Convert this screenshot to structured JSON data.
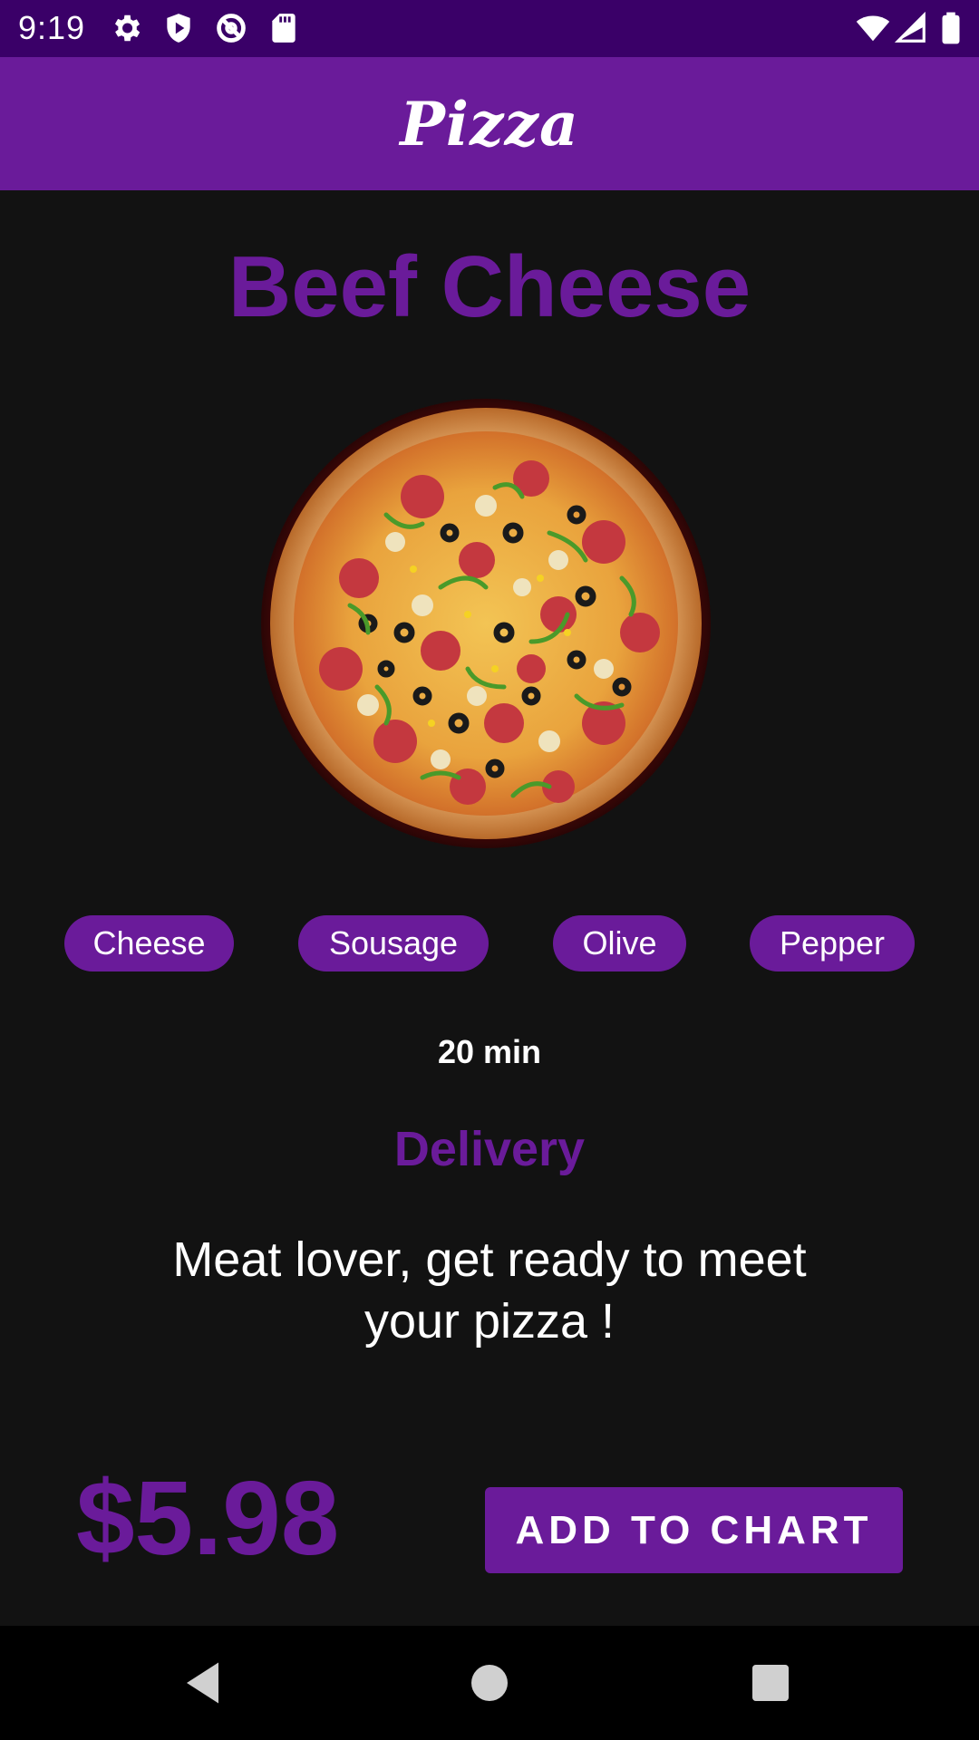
{
  "status_bar": {
    "time": "9:19",
    "icons": [
      "gear-icon",
      "shield-play-icon",
      "circle-slash-icon",
      "sd-card-icon",
      "wifi-icon",
      "signal-icon",
      "battery-icon"
    ]
  },
  "app_bar": {
    "title": "Pizza"
  },
  "pizza": {
    "name": "Beef Cheese",
    "image": "pizza-image",
    "toppings": [
      "Cheese",
      "Sousage",
      "Olive",
      "Pepper"
    ],
    "time": "20 min",
    "delivery": "Delivery",
    "description": "Meat lover, get ready to meet your pizza !",
    "price": "$5.98"
  },
  "actions": {
    "add_label": "ADD TO CHART"
  },
  "nav_bar": {
    "buttons": [
      "back-icon",
      "home-icon",
      "recents-icon"
    ]
  },
  "colors": {
    "primary": "#6a1b9a",
    "status_bar": "#3a0068",
    "background": "#121212"
  }
}
